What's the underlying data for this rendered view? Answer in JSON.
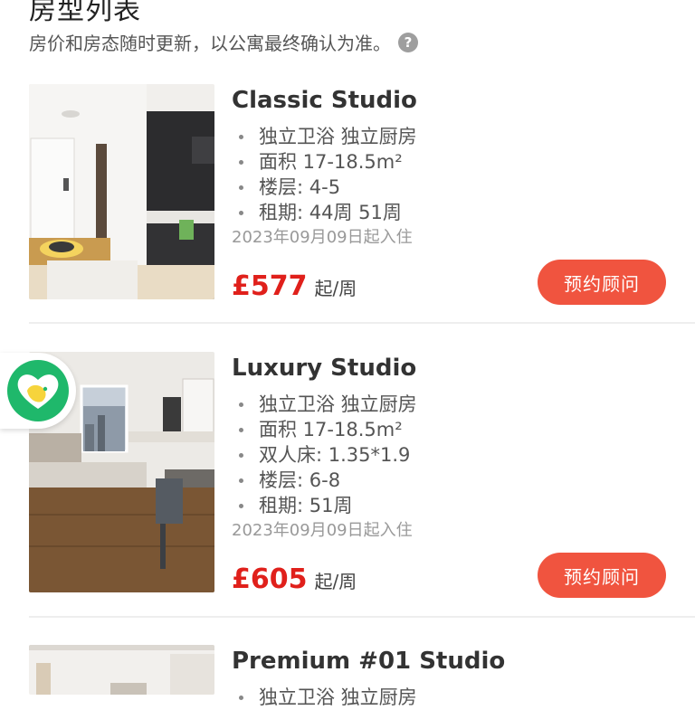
{
  "header": {
    "title": "房型列表",
    "subtitle": "房价和房态随时更新，以公寓最终确认为准。",
    "help_icon": "?"
  },
  "rooms": [
    {
      "name": "Classic Studio",
      "features": [
        "独立卫浴 独立厨房",
        "面积 17-18.5m²",
        "楼层: 4-5",
        "租期:  44周 51周"
      ],
      "move_in": "2023年09月09日起入住",
      "price": "£577",
      "price_unit": "起/周",
      "button_label": "预约顾问"
    },
    {
      "name": "Luxury Studio",
      "features": [
        "独立卫浴 独立厨房",
        "面积 17-18.5m²",
        "双人床:  1.35*1.9",
        "楼层: 6-8",
        "租期:  51周"
      ],
      "move_in": "2023年09月09日起入住",
      "price": "£605",
      "price_unit": "起/周",
      "button_label": "预约顾问"
    },
    {
      "name": "Premium #01 Studio",
      "features": [
        "独立卫浴 独立厨房"
      ]
    }
  ],
  "float_badge": {
    "icon": "heart-app-icon"
  },
  "colors": {
    "accent_button": "#f0543f",
    "price_red": "#e0201b",
    "badge_green": "#1fb86b",
    "badge_yellow": "#f6d43c"
  }
}
